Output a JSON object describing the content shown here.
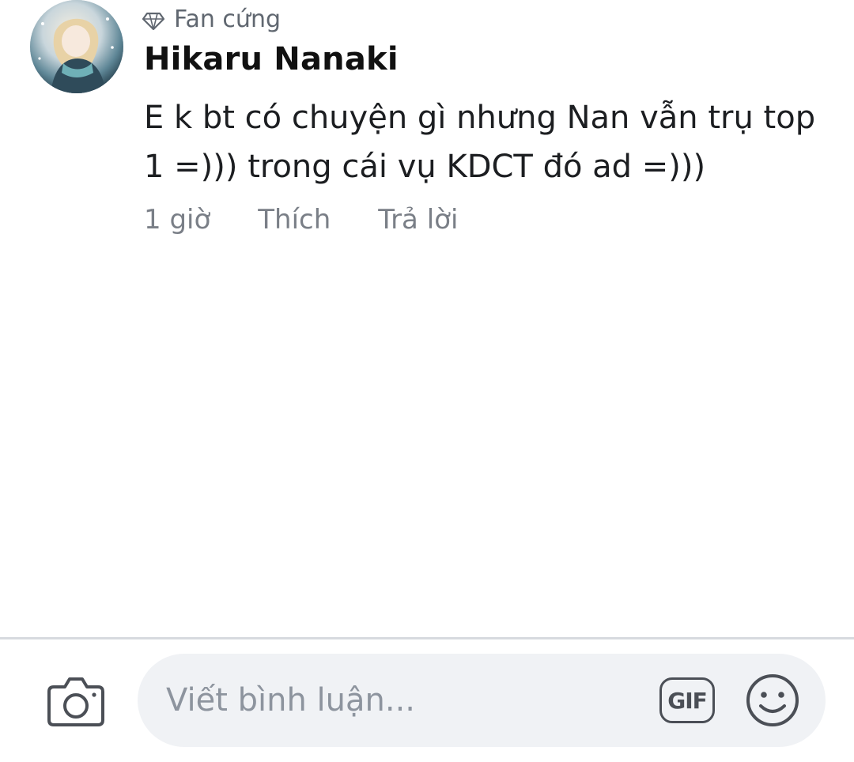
{
  "comment": {
    "badge_icon": "diamond-icon",
    "badge_label": "Fan cứng",
    "author_name": "Hikaru Nanaki",
    "text": "E k bt có chuyện gì nhưng Nan vẫn trụ top 1 =))) trong cái vụ KDCT đó ad =)))",
    "timestamp": "1 giờ",
    "like_label": "Thích",
    "reply_label": "Trả lời"
  },
  "composer": {
    "camera_icon": "camera-icon",
    "placeholder": "Viết bình luận...",
    "gif_label": "GIF",
    "emoji_icon": "smiley-icon"
  },
  "colors": {
    "background": "#ffffff",
    "input_bg": "#f0f2f5",
    "secondary_text": "#606770",
    "divider": "#d7dadf"
  }
}
